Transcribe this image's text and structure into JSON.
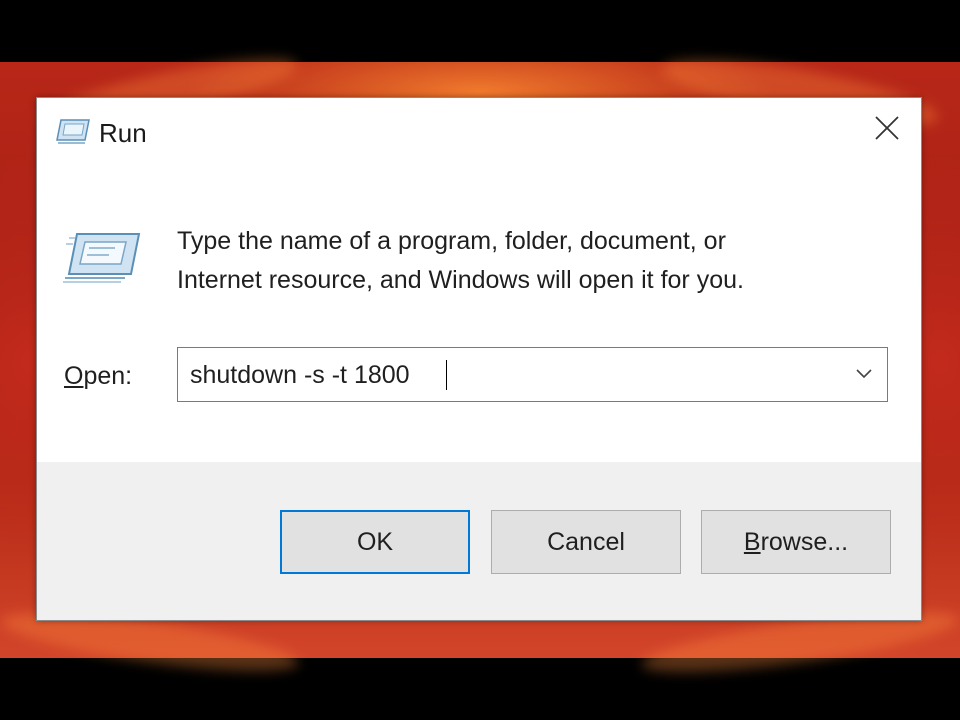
{
  "window": {
    "title": "Run"
  },
  "dialog": {
    "description_line1": "Type the name of a program, folder, document, or",
    "description_line2": "Internet resource, and Windows will open it for you.",
    "open_label_accel": "O",
    "open_label_rest": "pen:",
    "open_value": "shutdown -s -t 1800",
    "open_placeholder": ""
  },
  "buttons": {
    "ok_label": "OK",
    "cancel_label": "Cancel",
    "browse_accel": "B",
    "browse_rest": "rowse..."
  },
  "icons": {
    "title": "run-icon",
    "content": "run-icon",
    "close": "close-icon",
    "dropdown": "chevron-down-icon"
  },
  "colors": {
    "default_button_border": "#0078d7",
    "wallpaper": "#b82718"
  }
}
